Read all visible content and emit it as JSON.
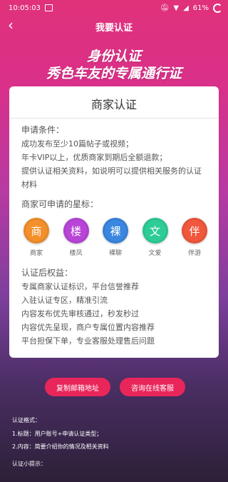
{
  "status_bar": {
    "time": "10:05:03",
    "battery": "61%"
  },
  "nav": {
    "title": "我要认证"
  },
  "hero": {
    "line1": "身份认证",
    "line2": "秀色车友的专属通行证"
  },
  "card": {
    "title": "商家认证",
    "conditions": {
      "heading": "申请条件：",
      "lines": [
        "成功发布至少10篇帖子或视频；",
        "年卡VIP以上，优质商家到期后全额退款；",
        "提供认证相关资料，如说明可以提供相关服务的认证",
        "材料"
      ]
    },
    "types_heading": "商家可申请的星标：",
    "types": [
      {
        "glyph": "商",
        "label": "商家",
        "color": "#f3902b"
      },
      {
        "glyph": "楼",
        "label": "楼凤",
        "color": "#b845d8"
      },
      {
        "glyph": "裸",
        "label": "裸聊",
        "color": "#3b86e0"
      },
      {
        "glyph": "文",
        "label": "文爱",
        "color": "#2ecd97"
      },
      {
        "glyph": "伴",
        "label": "伴游",
        "color": "#f0573c"
      }
    ],
    "benefits": {
      "heading": "认证后权益：",
      "lines": [
        "专属商家认证标识，平台信誉推荐",
        "入驻认证专区，精准引流",
        "内容发布优先审核通过，秒发秒过",
        "内容优先呈现，商户专属位置内容推荐",
        "平台担保下单，专业客服处理售后问题"
      ]
    }
  },
  "buttons": {
    "copy_email": "复制邮箱地址",
    "online_service": "咨询在线客服"
  },
  "footer": {
    "format_heading": "认证格式：",
    "format_1": "1.标题：用户账号+申请认证类型；",
    "format_2": "2.内容：简要介绍你的情况及相关资料",
    "tips_heading": "认证小提示："
  }
}
